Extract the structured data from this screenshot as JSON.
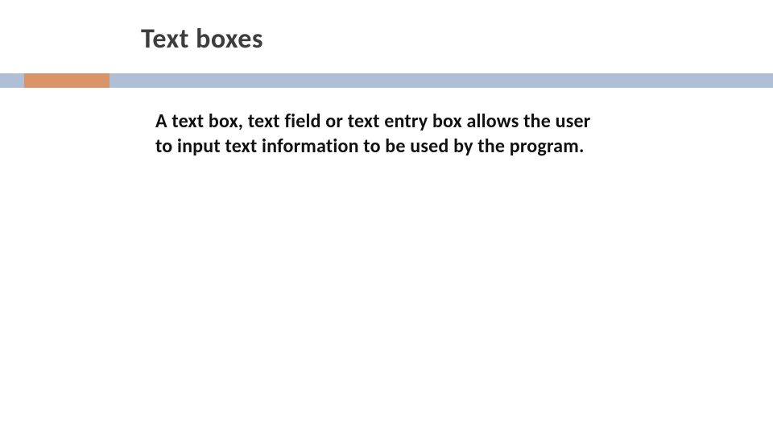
{
  "slide": {
    "title": "Text boxes",
    "body": "A text box, text field or text entry box allows the user to input text information to be used by the program."
  },
  "colors": {
    "divider_main": "#afc0d6",
    "divider_accent": "#d99569",
    "title": "#3d3d3d",
    "body": "#111111"
  }
}
